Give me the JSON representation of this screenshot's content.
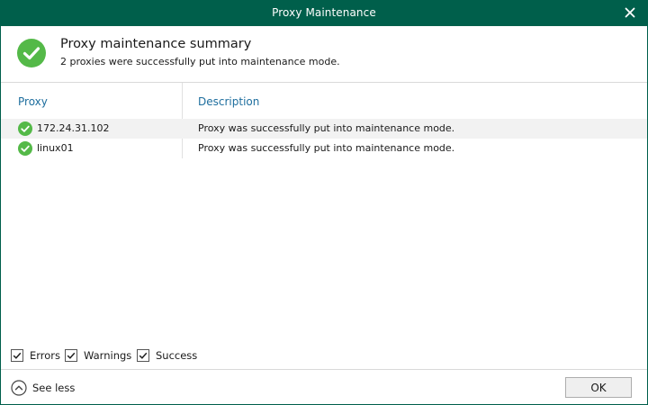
{
  "window": {
    "title": "Proxy Maintenance"
  },
  "header": {
    "title": "Proxy maintenance summary",
    "subtitle": "2 proxies were successfully put into maintenance mode."
  },
  "table": {
    "columns": [
      "Proxy",
      "Description"
    ],
    "rows": [
      {
        "status": "success-icon",
        "proxy": "172.24.31.102",
        "description": "Proxy was successfully put into maintenance mode."
      },
      {
        "status": "success-icon",
        "proxy": "linux01",
        "description": "Proxy was successfully put into maintenance mode."
      }
    ]
  },
  "filters": [
    {
      "label": "Errors",
      "checked": true
    },
    {
      "label": "Warnings",
      "checked": true
    },
    {
      "label": "Success",
      "checked": true
    }
  ],
  "footer": {
    "see_less_label": "See less",
    "ok_label": "OK"
  },
  "colors": {
    "titlebar": "#005f4b",
    "success": "#54b948",
    "column_header": "#1e6e9e"
  }
}
